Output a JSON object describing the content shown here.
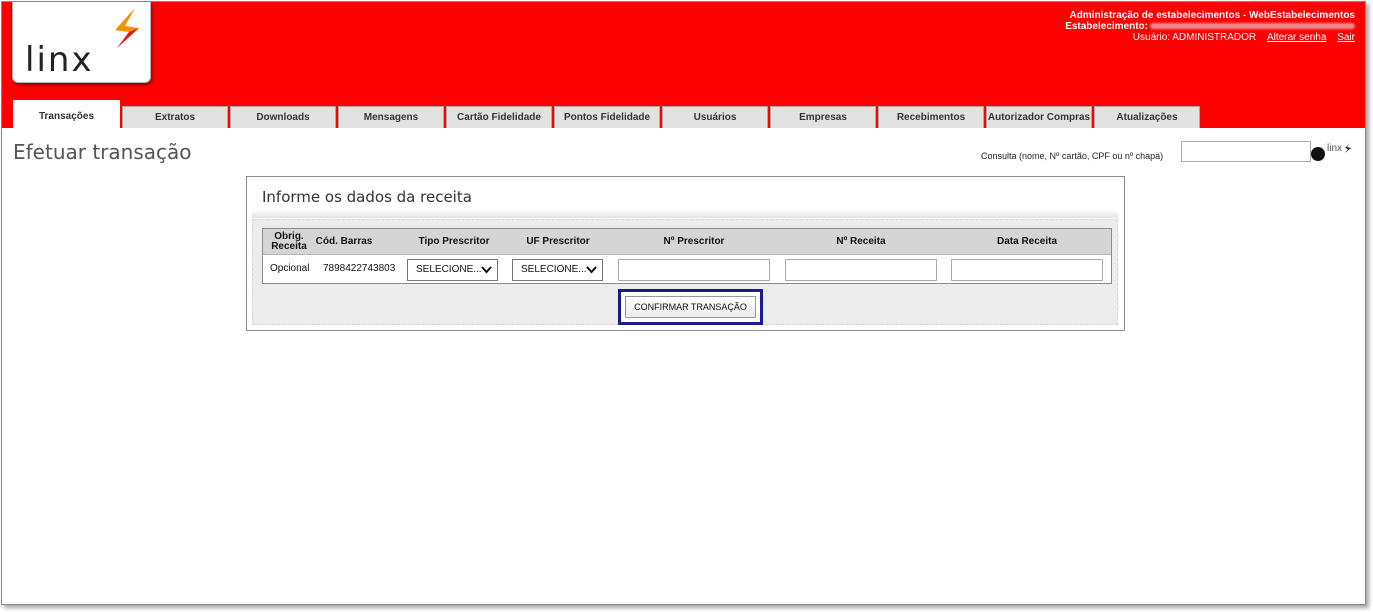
{
  "brand": {
    "logo_text": "linx",
    "accent_color": "#fd0000",
    "mark_color": "#f39200"
  },
  "header": {
    "app_title": "Administração de estabelecimentos - WebEstabelecimentos",
    "establishment_label": "Estabelecimento:",
    "user_label": "Usuário: ADMINISTRADOR",
    "change_password_link": "Alterar senha",
    "logout_link": "Sair"
  },
  "tabs": [
    {
      "label": "Transações",
      "active": true
    },
    {
      "label": "Extratos"
    },
    {
      "label": "Downloads"
    },
    {
      "label": "Mensagens"
    },
    {
      "label": "Cartão Fidelidade"
    },
    {
      "label": "Pontos Fidelidade"
    },
    {
      "label": "Usuários"
    },
    {
      "label": "Empresas"
    },
    {
      "label": "Recebimentos"
    },
    {
      "label": "Autorizador Compras"
    },
    {
      "label": "Atualizações"
    }
  ],
  "page": {
    "title": "Efetuar transação"
  },
  "consult": {
    "label": "Consulta (nome, Nº cartão, CPF ou nº chapa)",
    "value": "",
    "logo_text": "linx"
  },
  "panel": {
    "title": "Informe os dados da receita",
    "columns": {
      "obrig": "Obrig. Receita",
      "cod": "Cód. Barras",
      "tipo": "Tipo Prescritor",
      "uf": "UF Prescritor",
      "num_prescritor": "Nº Prescritor",
      "num_receita": "Nº Receita",
      "data": "Data Receita"
    },
    "row": {
      "obrig": "Opcional",
      "cod": "7898422743803",
      "tipo_selected": "SELECIONE...",
      "uf_selected": "SELECIONE...",
      "num_prescritor": "",
      "num_receita": "",
      "data": ""
    },
    "confirm_button": "CONFIRMAR TRANSAÇÃO"
  }
}
